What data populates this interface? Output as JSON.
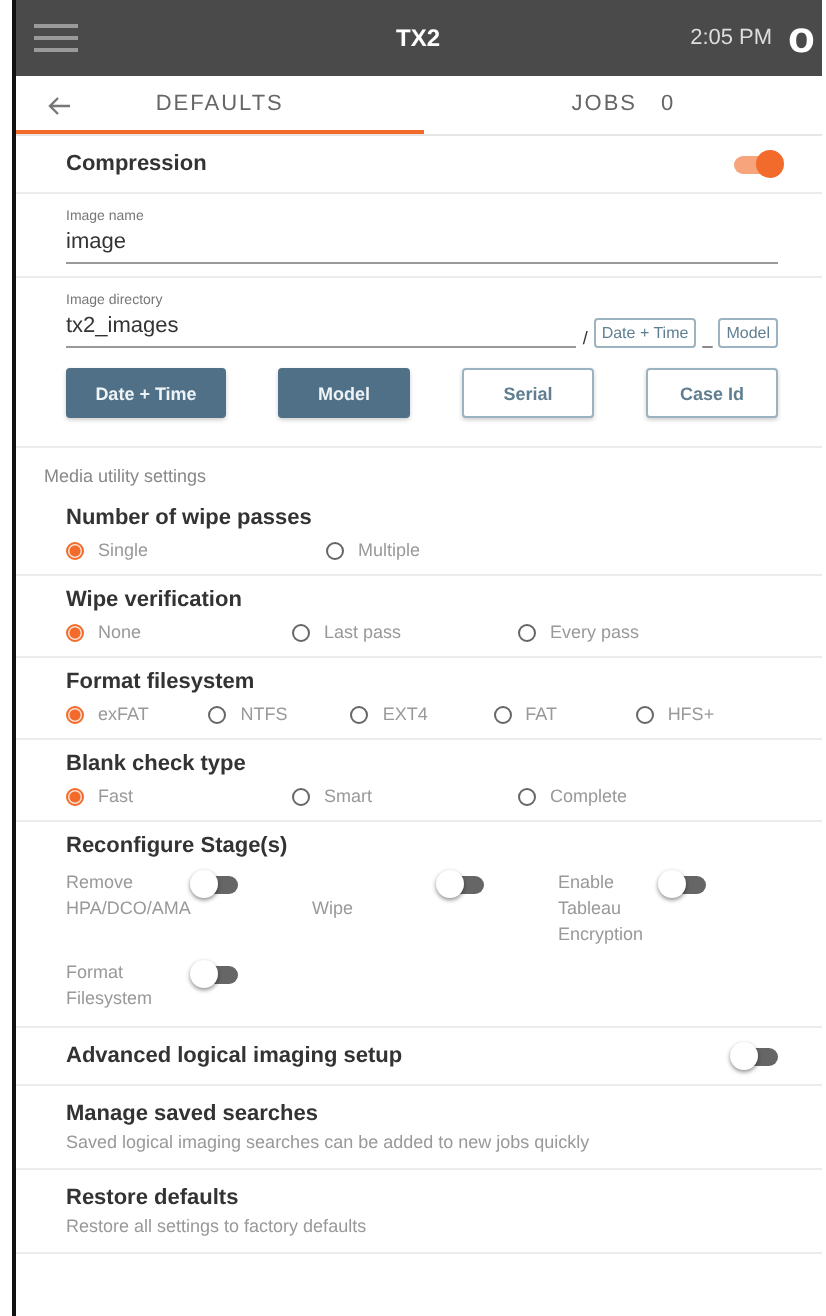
{
  "header": {
    "title": "TX2",
    "time": "2:05 PM",
    "logo": "o"
  },
  "tabs": [
    {
      "label": "DEFAULTS",
      "selected": true
    },
    {
      "label": "JOBS",
      "count": "0",
      "selected": false
    }
  ],
  "compression": {
    "label": "Compression",
    "on": true
  },
  "image_name": {
    "label": "Image name",
    "value": "image"
  },
  "image_directory": {
    "label": "Image directory",
    "value": "tx2_images",
    "suffix": [
      {
        "kind": "sep",
        "text": "/"
      },
      {
        "kind": "token",
        "text": "Date + Time"
      },
      {
        "kind": "sep",
        "text": "_"
      },
      {
        "kind": "token",
        "text": "Model"
      }
    ]
  },
  "token_buttons": [
    {
      "label": "Date + Time",
      "selected": true
    },
    {
      "label": "Model",
      "selected": true
    },
    {
      "label": "Serial",
      "selected": false
    },
    {
      "label": "Case Id",
      "selected": false
    }
  ],
  "section_label": "Media utility settings",
  "radio_groups": [
    {
      "title": "Number of wipe passes",
      "options": [
        {
          "label": "Single",
          "selected": true
        },
        {
          "label": "Multiple",
          "selected": false
        }
      ]
    },
    {
      "title": "Wipe verification",
      "options": [
        {
          "label": "None",
          "selected": true
        },
        {
          "label": "Last pass",
          "selected": false
        },
        {
          "label": "Every pass",
          "selected": false
        }
      ]
    },
    {
      "title": "Format filesystem",
      "options": [
        {
          "label": "exFAT",
          "selected": true
        },
        {
          "label": "NTFS",
          "selected": false
        },
        {
          "label": "EXT4",
          "selected": false
        },
        {
          "label": "FAT",
          "selected": false
        },
        {
          "label": "HFS+",
          "selected": false
        }
      ]
    },
    {
      "title": "Blank check type",
      "options": [
        {
          "label": "Fast",
          "selected": true
        },
        {
          "label": "Smart",
          "selected": false
        },
        {
          "label": "Complete",
          "selected": false
        }
      ]
    }
  ],
  "reconfigure": {
    "title": "Reconfigure Stage(s)",
    "stages": [
      {
        "label": "Remove HPA/DCO/AMA",
        "on": false
      },
      {
        "label": "Wipe",
        "on": false
      },
      {
        "label": "Enable Tableau Encryption",
        "on": false
      },
      {
        "label": "Format Filesystem",
        "on": false
      }
    ]
  },
  "advanced": {
    "label": "Advanced logical imaging setup",
    "on": false
  },
  "links": [
    {
      "title": "Manage saved searches",
      "description": "Saved logical imaging searches can be added to new jobs quickly"
    },
    {
      "title": "Restore defaults",
      "description": "Restore all settings to factory defaults"
    }
  ]
}
